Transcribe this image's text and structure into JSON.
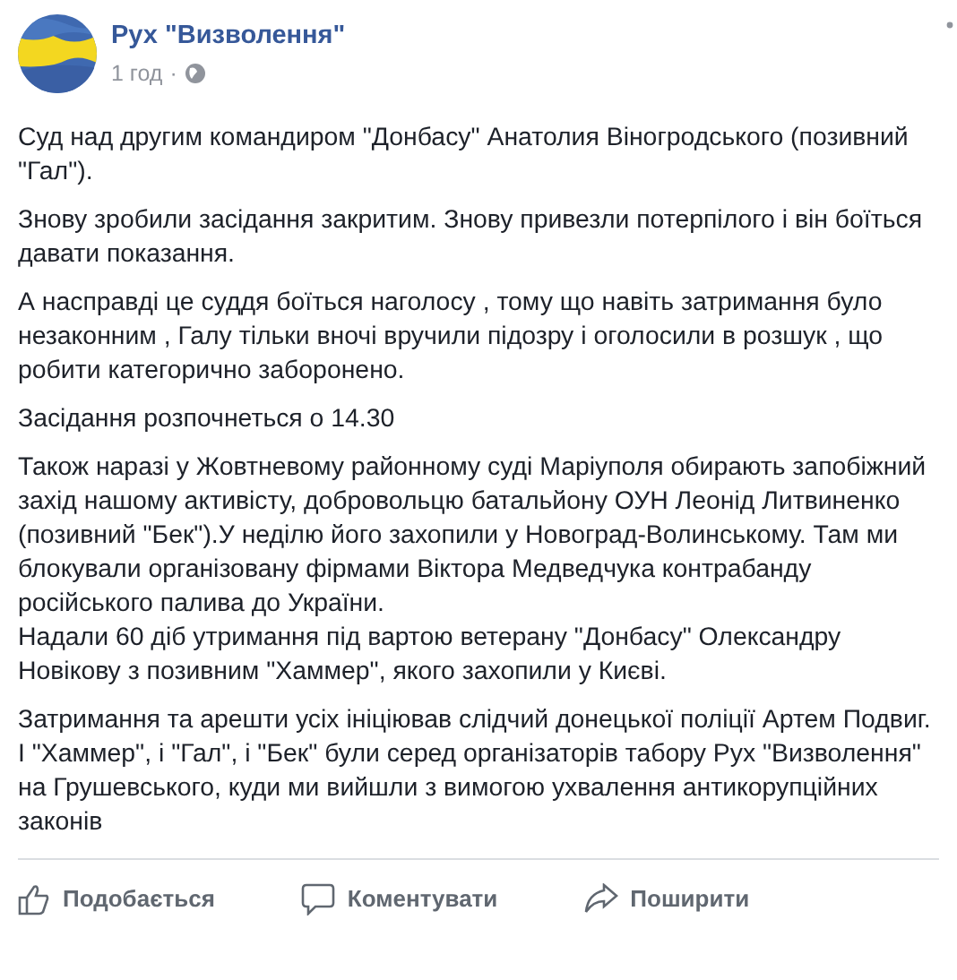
{
  "post": {
    "author": "Рух \"Визволення\"",
    "time": "1 год",
    "separator": "·",
    "paragraphs": [
      {
        "lines": [
          "Суд над другим командиром \"Донбасу\" Анатолия Віногродського (позивний \"Гал\")."
        ]
      },
      {
        "lines": [
          "Знову зробили засідання закритим. Знову привезли потерпілого і він боїться давати показання."
        ]
      },
      {
        "lines": [
          "А насправді це суддя боїться наголосу , тому що навіть затримання було незаконним , Галу тільки вночі вручили підозру і оголосили в розшук , що робити категорично заборонено."
        ]
      },
      {
        "lines": [
          "Засідання розпочнеться о 14.30"
        ]
      },
      {
        "lines": [
          "Також наразі у Жовтневому районному суді Маріуполя обирають запобіжний захід нашому активісту, добровольцю батальйону ОУН Леонід Литвиненко (позивний \"Бек\").У неділю його захопили у Новоград-Волинському. Там ми блокували організовану фірмами Віктора Медведчука контрабанду російського палива до України.",
          "Надали 60 діб утримання під вартою ветерану \"Донбасу\" Олександру Новікову з позивним \"Хаммер\", якого захопили у Києві."
        ]
      },
      {
        "lines": [
          "Затримання та арешти усіх ініціював слідчий донецької поліції Артем Подвиг. І \"Хаммер\", і \"Гал\", і \"Бек\" були серед організаторів табору Рух \"Визволення\" на Грушевського, куди ми вийшли з вимогою ухвалення антикорупційних законів"
        ]
      }
    ],
    "actions": [
      {
        "kind": "like",
        "label": "Подобається"
      },
      {
        "kind": "comment",
        "label": "Коментувати"
      },
      {
        "kind": "share",
        "label": "Поширити"
      }
    ]
  }
}
